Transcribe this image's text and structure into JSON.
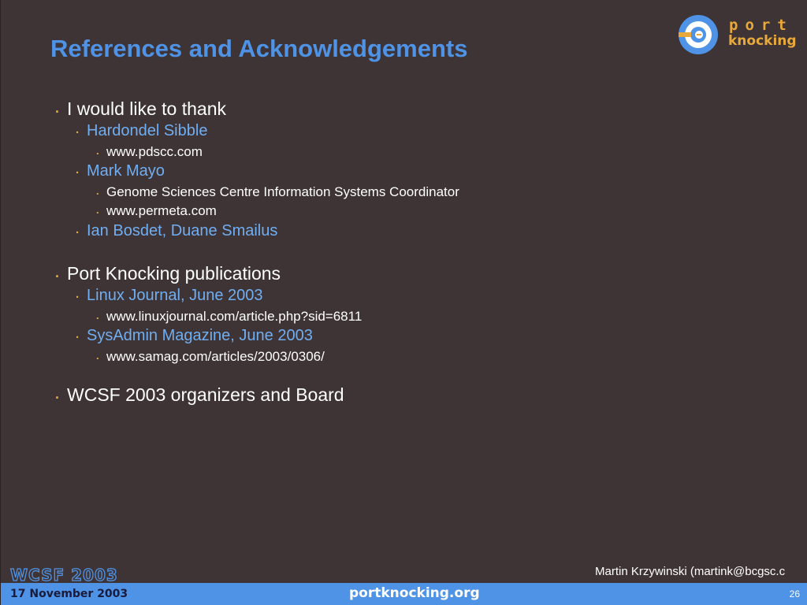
{
  "slide": {
    "title": "References and Acknowledgements",
    "logo": {
      "line1": "port",
      "line2": "knocking",
      "icon": "port-knocking-logo-icon"
    },
    "bullets": [
      {
        "level": 1,
        "text": "I would like to thank"
      },
      {
        "level": 2,
        "text": "Hardondel Sibble"
      },
      {
        "level": 3,
        "text": "www.pdscc.com"
      },
      {
        "level": 2,
        "text": "Mark Mayo"
      },
      {
        "level": 3,
        "text": "Genome Sciences Centre Information Systems Coordinator"
      },
      {
        "level": 3,
        "text": "www.permeta.com"
      },
      {
        "level": 2,
        "text": "Ian Bosdet, Duane Smailus"
      },
      {
        "level": 1,
        "text": "Port Knocking publications"
      },
      {
        "level": 2,
        "text": "Linux Journal, June 2003"
      },
      {
        "level": 3,
        "text": "www.linuxjournal.com/article.php?sid=6811"
      },
      {
        "level": 2,
        "text": "SysAdmin Magazine, June 2003"
      },
      {
        "level": 3,
        "text": "www.samag.com/articles/2003/0306/"
      },
      {
        "level": 1,
        "text": "WCSF 2003 organizers and Board"
      }
    ],
    "bullet_glyph": ".",
    "author": "Martin Krzywinski (martink@bcgsc.c",
    "footer": {
      "conference": "WCSF 2003",
      "date": "17 November 2003",
      "site": "portknocking.org",
      "page_number": "26"
    }
  },
  "colors": {
    "background": "#3e3436",
    "accent": "#4f93e6",
    "subitem": "#70aef2",
    "bullet": "#e8a93a"
  }
}
